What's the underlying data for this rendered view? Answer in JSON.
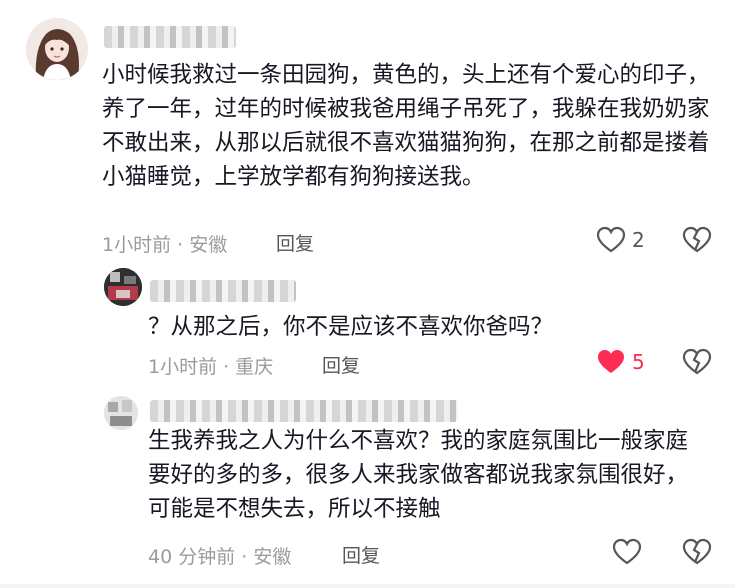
{
  "comments": [
    {
      "text": "小时候我救过一条田园狗，黄色的，头上还有个爱心的印子，养了一年，过年的时候被我爸用绳子吊死了，我躲在我奶奶家不敢出来，从那以后就很不喜欢猫猫狗狗，在那之前都是搂着小猫睡觉，上学放学都有狗狗接送我。",
      "meta": "1小时前 · 安徽",
      "reply_label": "回复",
      "likes": "2",
      "liked": false
    },
    {
      "text": "？从那之后，你不是应该不喜欢你爸吗？",
      "meta": "1小时前 · 重庆",
      "reply_label": "回复",
      "likes": "5",
      "liked": true
    },
    {
      "text": "生我养我之人为什么不喜欢？我的家庭氛围比一般家庭要好的多的多，很多人来我家做客都说我家氛围很好，可能是不想失去，所以不接触",
      "meta": "40 分钟前 · 安徽",
      "reply_label": "回复",
      "likes": "",
      "liked": false
    }
  ],
  "colors": {
    "accent": "#fe2c55",
    "meta": "#9a9ba0",
    "text": "#161823"
  },
  "icons": {
    "like": "heart-outline-icon",
    "liked": "heart-filled-icon",
    "dislike": "broken-heart-icon"
  }
}
